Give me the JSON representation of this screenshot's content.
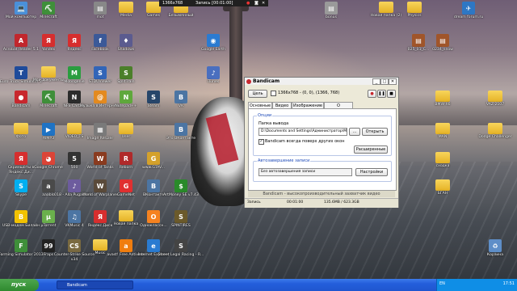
{
  "desktop": {
    "icons": [
      {
        "label": "Мой компьютер",
        "glyph": "💻",
        "color": "#4a90d9"
      },
      {
        "label": "Minecraft",
        "glyph": "⛏",
        "color": "#3f8f3a"
      },
      {
        "label": "mot",
        "glyph": "▤",
        "color": "#888888"
      },
      {
        "label": "Media",
        "glyph": "",
        "color": "folder"
      },
      {
        "label": "Games",
        "glyph": "",
        "color": "folder"
      },
      {
        "label": "Безымянный",
        "glyph": "",
        "color": "folder"
      },
      {
        "label": "bonus",
        "glyph": "▤",
        "color": "#9a9a9a"
      },
      {
        "label": "Новая папка (2)",
        "glyph": "",
        "color": "folder"
      },
      {
        "label": "Physics",
        "glyph": "",
        "color": "folder"
      },
      {
        "label": "dream forum.ru",
        "glyph": "✈",
        "color": "#2e77c4"
      },
      {
        "label": "Acrobat Reader 5.1",
        "glyph": "A",
        "color": "#c1272d"
      },
      {
        "label": "Yandex",
        "glyph": "Я",
        "color": "#d62e2e"
      },
      {
        "label": "Яндекс",
        "glyph": "Я",
        "color": "#d62e2e"
      },
      {
        "label": "Facebook",
        "glyph": "f",
        "color": "#3b5998"
      },
      {
        "label": "Shadows",
        "glyph": "♦",
        "color": "#5b5b8f"
      },
      {
        "label": "Google Earth",
        "glyph": "◉",
        "color": "#2b7bd1"
      },
      {
        "label": "025_01_C...",
        "glyph": "▤",
        "color": "#a0552a"
      },
      {
        "label": "0234_snow",
        "glyph": "▤",
        "color": "#a0552a"
      },
      {
        "label": "Euro Truck Simulator 2",
        "glyph": "T",
        "color": "#1f4b9b"
      },
      {
        "label": "Мои документы",
        "glyph": "",
        "color": "folder"
      },
      {
        "label": "Mobogenie",
        "glyph": "M",
        "color": "#2a9d3f"
      },
      {
        "label": "STDUViewer",
        "glyph": "S",
        "color": "#3265b8"
      },
      {
        "label": "SplitTrain",
        "glyph": "S",
        "color": "#4b7f2a"
      },
      {
        "label": "iTunes",
        "glyph": "♪",
        "color": "#4a6fbf"
      },
      {
        "label": "Bandicam",
        "glyph": "●",
        "color": "#c8282e"
      },
      {
        "label": "Minecraft",
        "glyph": "⛏",
        "color": "#3f8f3a"
      },
      {
        "label": "NFS Carbon",
        "glyph": "N",
        "color": "#2c2c2c"
      },
      {
        "label": "Музыка в Интернете",
        "glyph": "@",
        "color": "#e38a1f"
      },
      {
        "label": "Notepad++",
        "glyph": "N",
        "color": "#5fa83c"
      },
      {
        "label": "Steam",
        "glyph": "S",
        "color": "#27466a"
      },
      {
        "label": "VK",
        "glyph": "В",
        "color": "#4c75a3"
      },
      {
        "label": "BMW X6",
        "glyph": "",
        "color": "folder"
      },
      {
        "label": "VAZ 2107",
        "glyph": "",
        "color": "folder"
      },
      {
        "label": "Фото",
        "glyph": "",
        "color": "folder"
      },
      {
        "label": "AIMP3",
        "glyph": "▶",
        "color": "#1f73c4"
      },
      {
        "label": "VIDEO_TS",
        "glyph": "",
        "color": "folder"
      },
      {
        "label": "Image Resizer",
        "glyph": "▦",
        "color": "#7a7a7a"
      },
      {
        "label": "User",
        "glyph": "",
        "color": "folder"
      },
      {
        "label": "Это ВКонтакте",
        "glyph": "В",
        "color": "#4c75a3"
      },
      {
        "label": "MAN",
        "glyph": "",
        "color": "folder"
      },
      {
        "label": "Dodge Challenger",
        "glyph": "",
        "color": "folder"
      },
      {
        "label": "Скриншоты в Яндекс.Ди...",
        "glyph": "Я",
        "color": "#d62e2e"
      },
      {
        "label": "Google Chrome",
        "glyph": "◕",
        "color": "#db4437"
      },
      {
        "label": "500",
        "glyph": "5",
        "color": "#333333"
      },
      {
        "label": "World of Tanks",
        "glyph": "W",
        "color": "#8a3b1f"
      },
      {
        "label": "Reborn",
        "glyph": "R",
        "color": "#b02a2a"
      },
      {
        "label": "www.GTAV...",
        "glyph": "G",
        "color": "#d4a12b"
      },
      {
        "label": "сходка",
        "glyph": "",
        "color": "folder"
      },
      {
        "label": "Skype",
        "glyph": "S",
        "color": "#00aff0"
      },
      {
        "label": "aaablo",
        "glyph": "a",
        "color": "#4a4a4a"
      },
      {
        "label": "018 - Alla Pugachev...",
        "glyph": "♪",
        "color": "#6d5c9e"
      },
      {
        "label": "World of Warplanes",
        "glyph": "W",
        "color": "#5a4a3a"
      },
      {
        "label": "GameNet",
        "glyph": "G",
        "color": "#e03030"
      },
      {
        "label": "ВКонтакте",
        "glyph": "В",
        "color": "#4c75a3"
      },
      {
        "label": "ArtMoney SE v7.43",
        "glyph": "$",
        "color": "#2a8a2a"
      },
      {
        "label": "БГАН",
        "glyph": "",
        "color": "folder"
      },
      {
        "label": "USB-модем Билайн",
        "glyph": "B",
        "color": "#f2c200"
      },
      {
        "label": "µTorrent",
        "glyph": "µ",
        "color": "#6ab04c"
      },
      {
        "label": "VKMusic 4",
        "glyph": "♫",
        "color": "#4c75a3"
      },
      {
        "label": "Яндекс.Диск",
        "glyph": "Я",
        "color": "#d62e2e"
      },
      {
        "label": "Новая папка",
        "glyph": "",
        "color": "folder"
      },
      {
        "label": "Одноклассн...",
        "glyph": "О",
        "color": "#f58220"
      },
      {
        "label": "SPINTIRES",
        "glyph": "S",
        "color": "#6b5a2b"
      },
      {
        "label": "Farming Simulator 2013",
        "glyph": "F",
        "color": "#3f8f3a"
      },
      {
        "label": "Fraps",
        "glyph": "99",
        "color": "#222222"
      },
      {
        "label": "Counter-Strike Source v34",
        "glyph": "CS",
        "color": "#7a6a40"
      },
      {
        "label": "Music",
        "glyph": "",
        "color": "folder"
      },
      {
        "label": "avast! Free Antivirus",
        "glyph": "a",
        "color": "#f07d0f"
      },
      {
        "label": "Internet Explorer",
        "glyph": "e",
        "color": "#2a7bd1"
      },
      {
        "label": "Street Legal Racing - R...",
        "glyph": "S",
        "color": "#444444"
      },
      {
        "label": "Корзина",
        "glyph": "♻",
        "color": "#5e8ec8"
      }
    ]
  },
  "capture_bar": {
    "resolution": "1366x768",
    "record_label": "Запись [00:01:00]"
  },
  "bandicam": {
    "title": "Bandicam",
    "target_button": "Цель",
    "region_text": "1366x768 - (0, 0), (1366, 768)",
    "rec_button": "●",
    "tabs": [
      "Основные",
      "Видео",
      "Изображение",
      "О программе"
    ],
    "options_group": "Опции",
    "output_folder_label": "Папка вывода",
    "output_folder_value": "D:\\Documents and Settings\\Администратор\\Мо",
    "browse_button": "...",
    "open_button": "Открыть",
    "on_top_label": "Bandicam всегда поверх других окон",
    "advanced_button": "Расширенные",
    "auto_stop_group": "Автозавершение записи",
    "auto_stop_value": "Без автозавершения записи",
    "settings_button": "Настройки",
    "footer_text": "Bandicam - высокопроизводительный захватчик видео",
    "status": {
      "state": "Запись",
      "time": "00:01:00",
      "size": "135.6MB / 623.3GB"
    }
  },
  "taskbar": {
    "start_label": "пуск",
    "task_label": "Bandicam",
    "tray_lang": "EN",
    "clock": "17:51"
  }
}
